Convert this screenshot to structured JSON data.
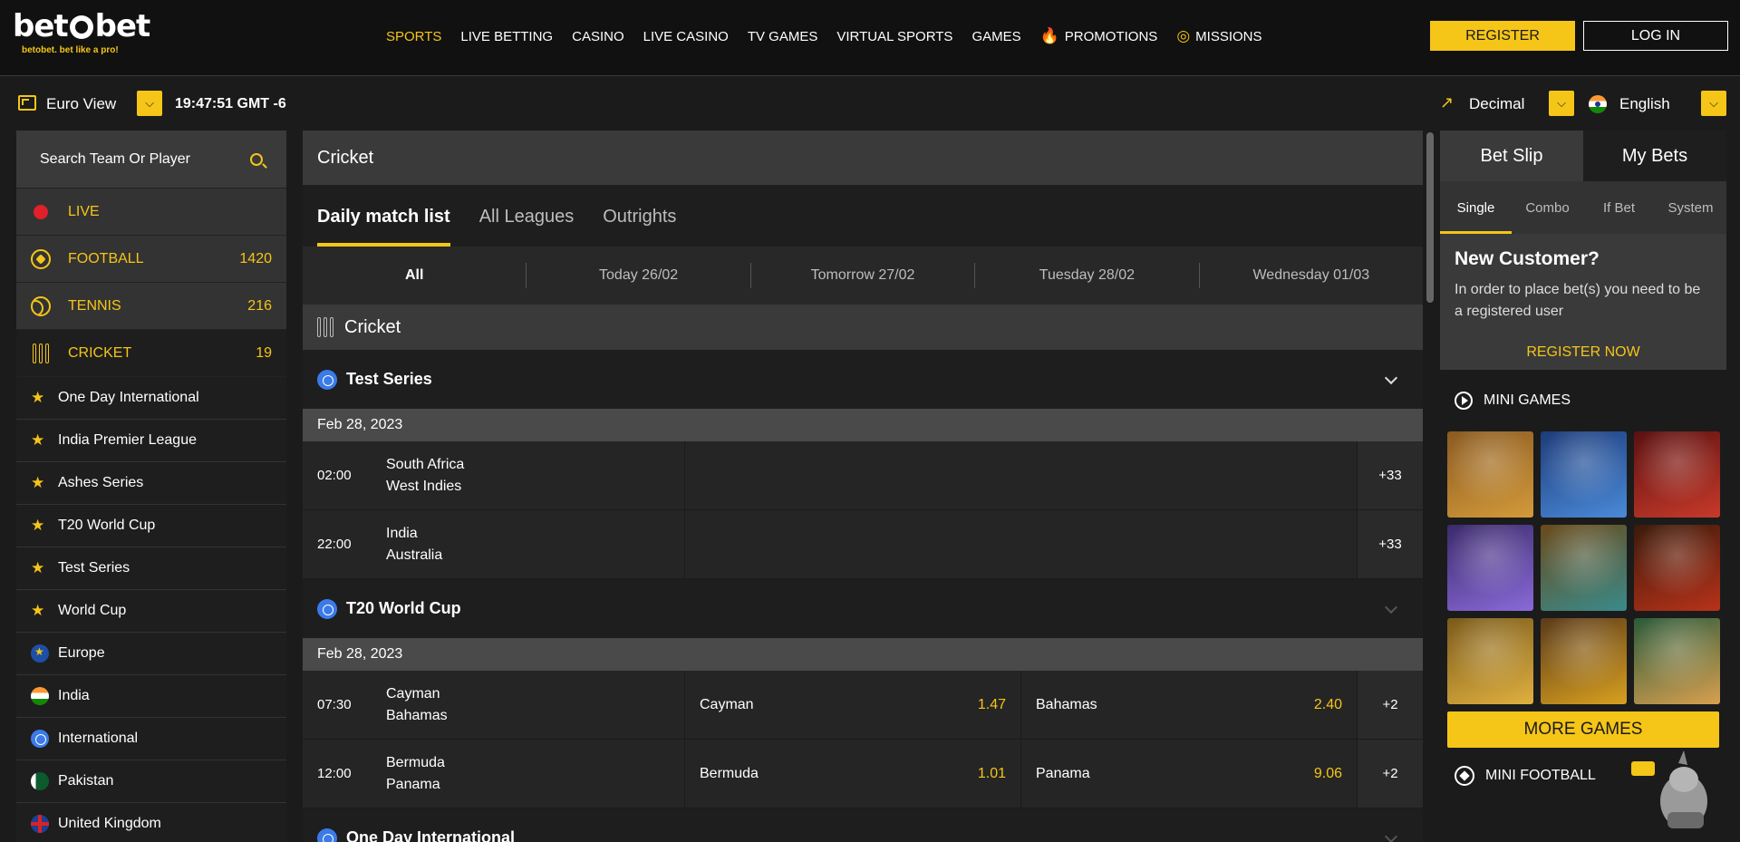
{
  "header": {
    "logo_text_1": "bet",
    "logo_text_2": "bet",
    "tagline": "betobet. bet like a pro!",
    "nav": [
      {
        "label": "SPORTS",
        "state": "active"
      },
      {
        "label": "LIVE BETTING"
      },
      {
        "label": "CASINO"
      },
      {
        "label": "LIVE CASINO"
      },
      {
        "label": "TV GAMES"
      },
      {
        "label": "VIRTUAL SPORTS"
      },
      {
        "label": "GAMES"
      },
      {
        "label": "PROMOTIONS",
        "icon": "flame-icon"
      },
      {
        "label": "MISSIONS",
        "icon": "target-icon"
      }
    ],
    "register_label": "REGISTER",
    "login_label": "LOG IN"
  },
  "subbar": {
    "view_label": "Euro View",
    "clock": "19:47:51 GMT -6",
    "odds_label": "Decimal",
    "language_label": "English"
  },
  "sidebar": {
    "search_placeholder": "Search Team Or Player",
    "sports": [
      {
        "name": "LIVE",
        "count": "",
        "icon": "live-dot-icon"
      },
      {
        "name": "FOOTBALL",
        "count": "1420",
        "icon": "football-icon"
      },
      {
        "name": "TENNIS",
        "count": "216",
        "icon": "tennis-icon"
      },
      {
        "name": "CRICKET",
        "count": "19",
        "icon": "cricket-icon"
      }
    ],
    "leagues": [
      {
        "name": "One Day International",
        "icon": "star-icon"
      },
      {
        "name": "India Premier League",
        "icon": "star-icon"
      },
      {
        "name": "Ashes Series",
        "icon": "star-icon"
      },
      {
        "name": "T20 World Cup",
        "icon": "star-icon"
      },
      {
        "name": "Test Series",
        "icon": "star-icon"
      },
      {
        "name": "World Cup",
        "icon": "star-icon"
      }
    ],
    "regions": [
      {
        "name": "Europe",
        "icon": "eu-flag-icon"
      },
      {
        "name": "India",
        "icon": "india-flag-icon"
      },
      {
        "name": "International",
        "icon": "globe-icon"
      },
      {
        "name": "Pakistan",
        "icon": "pakistan-flag-icon"
      },
      {
        "name": "United Kingdom",
        "icon": "uk-flag-icon"
      }
    ]
  },
  "main": {
    "title": "Cricket",
    "tabs": [
      {
        "label": "Daily match list",
        "state": "active"
      },
      {
        "label": "All Leagues"
      },
      {
        "label": "Outrights"
      }
    ],
    "dates": [
      {
        "label": "All",
        "state": "active"
      },
      {
        "label": "Today 26/02"
      },
      {
        "label": "Tomorrow 27/02"
      },
      {
        "label": "Tuesday 28/02"
      },
      {
        "label": "Wednesday 01/03"
      }
    ],
    "sport_header": "Cricket",
    "competitions": [
      {
        "name": "Test Series",
        "date": "Feb 28, 2023",
        "matches": [
          {
            "time": "02:00",
            "home": "South Africa",
            "away": "West Indies",
            "more": "+33"
          },
          {
            "time": "22:00",
            "home": "India",
            "away": "Australia",
            "more": "+33"
          }
        ]
      },
      {
        "name": "T20 World Cup",
        "date": "Feb 28, 2023",
        "matches": [
          {
            "time": "07:30",
            "home": "Cayman",
            "away": "Bahamas",
            "odd1_team": "Cayman",
            "odd1": "1.47",
            "odd2_team": "Bahamas",
            "odd2": "2.40",
            "more": "+2"
          },
          {
            "time": "12:00",
            "home": "Bermuda",
            "away": "Panama",
            "odd1_team": "Bermuda",
            "odd1": "1.01",
            "odd2_team": "Panama",
            "odd2": "9.06",
            "more": "+2"
          }
        ]
      },
      {
        "name": "One Day International"
      }
    ]
  },
  "betslip": {
    "tabs": [
      {
        "label": "Bet Slip",
        "state": "active"
      },
      {
        "label": "My Bets"
      }
    ],
    "types": [
      {
        "label": "Single",
        "state": "active"
      },
      {
        "label": "Combo"
      },
      {
        "label": "If Bet"
      },
      {
        "label": "System"
      }
    ],
    "new_customer_title": "New Customer?",
    "new_customer_text": "In order to place bet(s) you need to be a registered user",
    "register_now": "REGISTER NOW"
  },
  "mini_games": {
    "title": "MINI GAMES",
    "games": [
      {
        "colors": [
          "#8a5a20",
          "#d49a3a"
        ]
      },
      {
        "colors": [
          "#1d3b7a",
          "#4a8ad8"
        ]
      },
      {
        "colors": [
          "#5a1010",
          "#c83a2a"
        ]
      },
      {
        "colors": [
          "#3a2a6a",
          "#8a6ad8"
        ]
      },
      {
        "colors": [
          "#6a4a1a",
          "#3a8a8a"
        ]
      },
      {
        "colors": [
          "#3a1a0a",
          "#b8321a"
        ]
      },
      {
        "colors": [
          "#7a5a1a",
          "#e0b040"
        ]
      },
      {
        "colors": [
          "#5a3a1a",
          "#d8a020"
        ]
      },
      {
        "colors": [
          "#2a5a3a",
          "#d8a050"
        ]
      }
    ],
    "more_label": "MORE GAMES",
    "mini_football": "MINI FOOTBALL"
  },
  "colors": {
    "accent": "#f5c518",
    "promo": "#ff7a4d",
    "live": "#e0202a"
  }
}
